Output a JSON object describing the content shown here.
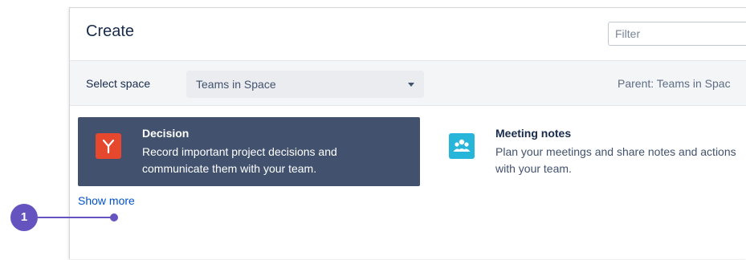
{
  "dialog": {
    "title": "Create",
    "filter_placeholder": "Filter"
  },
  "space_bar": {
    "label": "Select space",
    "selected_space": "Teams in Space",
    "parent_text": "Parent: Teams in Spac"
  },
  "templates": [
    {
      "title": "Decision",
      "description": "Record important project decisions and communicate them with your team.",
      "icon": "decision-icon",
      "icon_color": "#e5482d",
      "selected": true
    },
    {
      "title": "Meeting notes",
      "description": "Plan your meetings and share notes and actions with your team.",
      "icon": "meeting-notes-icon",
      "icon_color": "#27b6da",
      "selected": false
    }
  ],
  "show_more_label": "Show more",
  "callout": {
    "number": "1",
    "color": "#6554c0"
  },
  "colors": {
    "selected_card_bg": "#42526e",
    "link": "#0052cc"
  }
}
